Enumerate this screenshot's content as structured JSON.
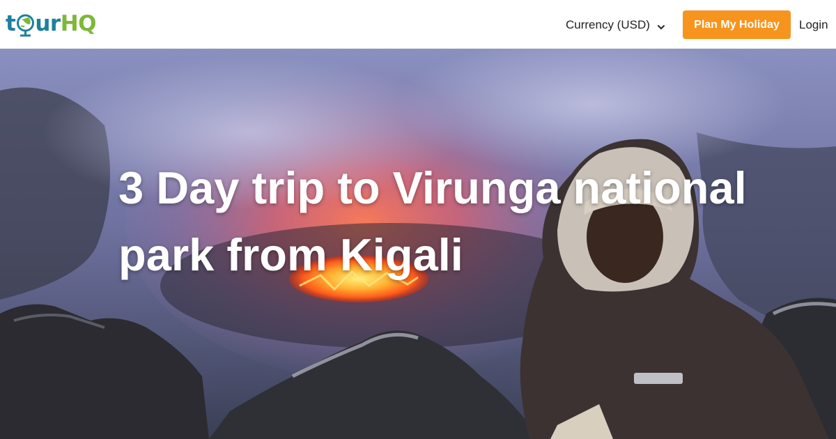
{
  "header": {
    "logo": {
      "part_tour_t": "t",
      "part_tour_rest": "ur",
      "part_hq": "HQ",
      "icon": "globe-icon"
    },
    "currency_label": "Currency (USD)",
    "currency_icon": "chevron-down-icon",
    "plan_button_label": "Plan My Holiday",
    "login_label": "Login"
  },
  "hero": {
    "title": "3 Day trip to Virunga national park from Kigali",
    "image_alt": "Person standing at the rim of a volcano crater with glowing lava lake"
  },
  "colors": {
    "brand_blue": "#1e7fa0",
    "brand_green": "#7db83a",
    "accent_orange": "#f7941d"
  }
}
